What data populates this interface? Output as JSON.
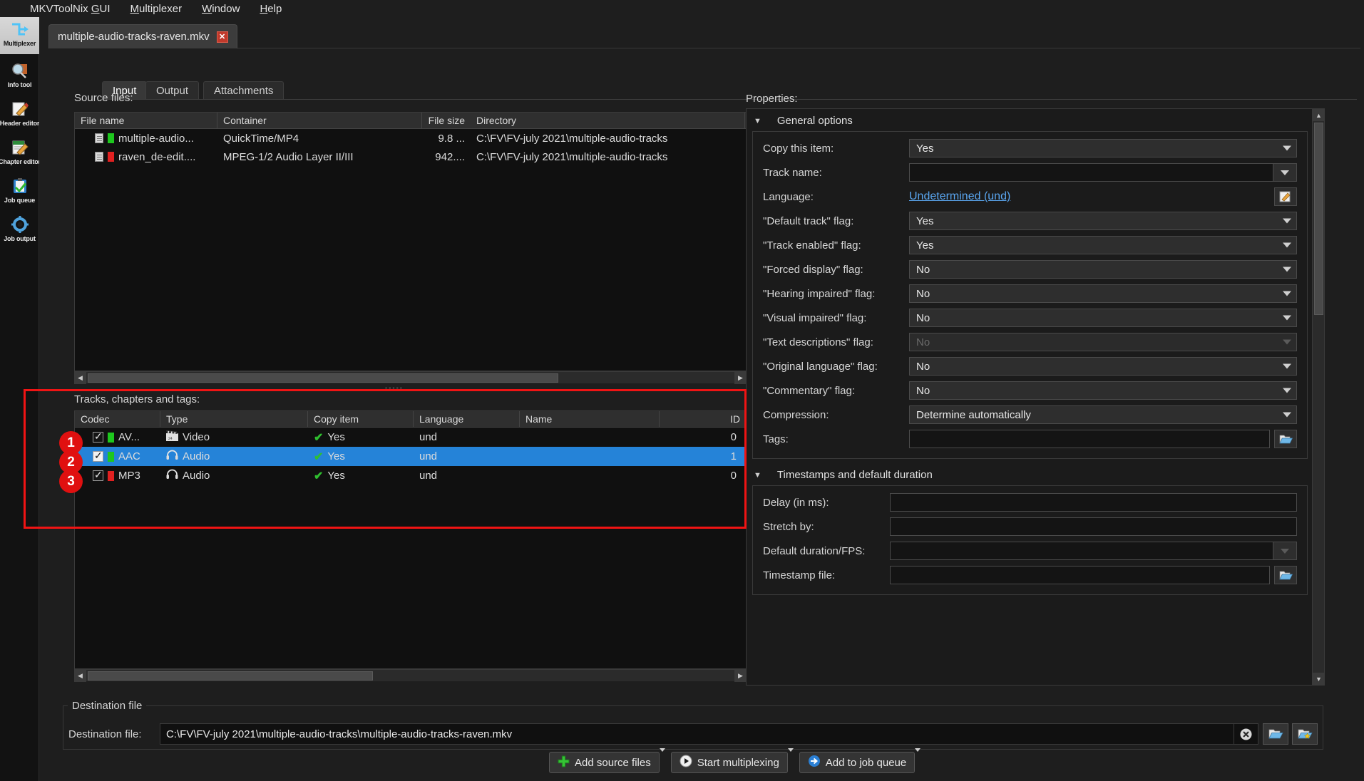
{
  "menu": {
    "app_title": "MKVToolNix GUI",
    "items": [
      "Multiplexer",
      "Window",
      "Help"
    ]
  },
  "rail": {
    "items": [
      {
        "label": "Multiplexer",
        "icon": "multiplexer-icon",
        "active": true
      },
      {
        "label": "Info tool",
        "icon": "info-tool-icon",
        "active": false
      },
      {
        "label": "Header editor",
        "icon": "header-editor-icon",
        "active": false
      },
      {
        "label": "Chapter editor",
        "icon": "chapter-editor-icon",
        "active": false
      },
      {
        "label": "Job queue",
        "icon": "job-queue-icon",
        "active": false
      },
      {
        "label": "Job output",
        "icon": "job-output-icon",
        "active": false
      }
    ]
  },
  "document_tab": {
    "title": "multiple-audio-tracks-raven.mkv",
    "close_icon": "close-icon"
  },
  "inner_tabs": [
    {
      "label": "Input",
      "selected": true
    },
    {
      "label": "Output",
      "selected": false
    },
    {
      "label": "Attachments",
      "selected": false
    }
  ],
  "source_files": {
    "label": "Source files:",
    "columns": [
      "File name",
      "Container",
      "File size",
      "Directory"
    ],
    "rows": [
      {
        "file_name": "multiple-audio...",
        "container": "QuickTime/MP4",
        "file_size": "9.8 ...",
        "directory": "C:\\FV\\FV-july 2021\\multiple-audio-tracks",
        "chip": "green"
      },
      {
        "file_name": "raven_de-edit....",
        "container": "MPEG-1/2 Audio Layer II/III",
        "file_size": "942....",
        "directory": "C:\\FV\\FV-july 2021\\multiple-audio-tracks",
        "chip": "red"
      }
    ]
  },
  "tracks": {
    "label": "Tracks, chapters and tags:",
    "columns": [
      "Codec",
      "Type",
      "Copy item",
      "Language",
      "Name",
      "ID"
    ],
    "rows": [
      {
        "checked": true,
        "chip": "green",
        "codec": "AV...",
        "type": "Video",
        "type_icon": "video-clapper-icon",
        "copy_item": "Yes",
        "language": "und",
        "name": "",
        "id": "0",
        "selected": false,
        "badge": "1"
      },
      {
        "checked": true,
        "chip": "green",
        "codec": "AAC",
        "type": "Audio",
        "type_icon": "headphones-icon",
        "copy_item": "Yes",
        "language": "und",
        "name": "",
        "id": "1",
        "selected": true,
        "badge": "2"
      },
      {
        "checked": true,
        "chip": "red",
        "codec": "MP3",
        "type": "Audio",
        "type_icon": "headphones-icon",
        "copy_item": "Yes",
        "language": "und",
        "name": "",
        "id": "0",
        "selected": false,
        "badge": "3"
      }
    ]
  },
  "properties": {
    "label": "Properties:",
    "groups": [
      {
        "title": "General options",
        "caret_icon": "chevron-down-icon",
        "fields": [
          {
            "label": "Copy this item:",
            "value": "Yes",
            "kind": "combo"
          },
          {
            "label": "Track name:",
            "value": "",
            "kind": "combo-split"
          },
          {
            "label": "Language:",
            "value": "Undetermined (und)",
            "kind": "link",
            "button_icon": "edit-pencil-icon"
          },
          {
            "label": "\"Default track\" flag:",
            "value": "Yes",
            "kind": "combo"
          },
          {
            "label": "\"Track enabled\" flag:",
            "value": "Yes",
            "kind": "combo"
          },
          {
            "label": "\"Forced display\" flag:",
            "value": "No",
            "kind": "combo"
          },
          {
            "label": "\"Hearing impaired\" flag:",
            "value": "No",
            "kind": "combo"
          },
          {
            "label": "\"Visual impaired\" flag:",
            "value": "No",
            "kind": "combo"
          },
          {
            "label": "\"Text descriptions\" flag:",
            "value": "No",
            "kind": "combo-disabled"
          },
          {
            "label": "\"Original language\" flag:",
            "value": "No",
            "kind": "combo"
          },
          {
            "label": "\"Commentary\" flag:",
            "value": "No",
            "kind": "combo"
          },
          {
            "label": "Compression:",
            "value": "Determine automatically",
            "kind": "combo"
          },
          {
            "label": "Tags:",
            "value": "",
            "kind": "text-browse",
            "button_icon": "folder-open-icon"
          }
        ]
      },
      {
        "title": "Timestamps and default duration",
        "caret_icon": "chevron-down-icon",
        "fields": [
          {
            "label": "Delay (in ms):",
            "value": "",
            "kind": "text"
          },
          {
            "label": "Stretch by:",
            "value": "",
            "kind": "text"
          },
          {
            "label": "Default duration/FPS:",
            "value": "",
            "kind": "combo-split-disabled"
          },
          {
            "label": "Timestamp file:",
            "value": "",
            "kind": "text-browse",
            "button_icon": "folder-open-icon"
          }
        ]
      }
    ]
  },
  "destination": {
    "legend": "Destination file",
    "label": "Destination file:",
    "value": "C:\\FV\\FV-july 2021\\multiple-audio-tracks\\multiple-audio-tracks-raven.mkv",
    "clear_icon": "clear-circle-icon",
    "browse_icon": "folder-open-icon",
    "favorite_icon": "folder-star-icon"
  },
  "buttons": [
    {
      "label": "Add source files",
      "icon": "plus-green-icon",
      "has_dropdown": true
    },
    {
      "label": "Start multiplexing",
      "icon": "play-circle-icon",
      "has_dropdown": true
    },
    {
      "label": "Add to job queue",
      "icon": "arrow-blue-icon",
      "has_dropdown": true
    }
  ],
  "colors": {
    "accent_selection": "#2583d8",
    "annotation_red": "#f01414",
    "link_blue": "#5aa6f0",
    "green_chip": "#1ec71e",
    "red_chip": "#e02020"
  }
}
